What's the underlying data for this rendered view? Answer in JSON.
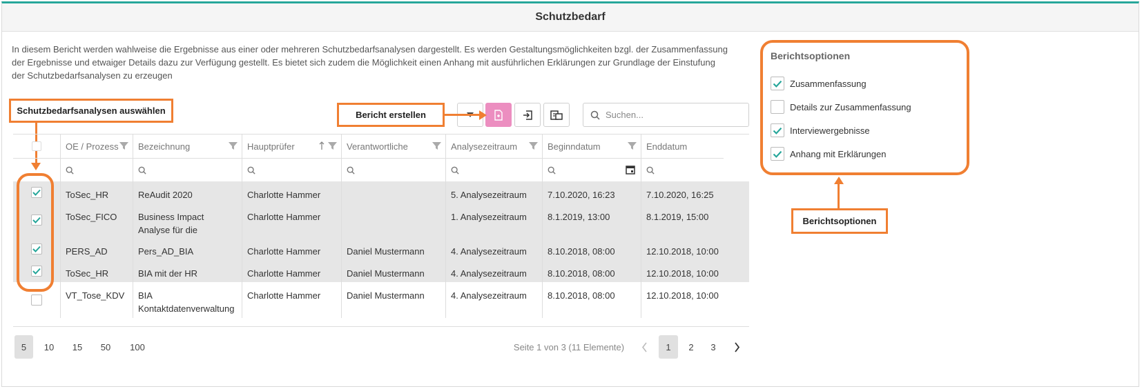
{
  "window": {
    "title": "Schutzbedarf"
  },
  "description": "In diesem Bericht werden wahlweise die Ergebnisse aus einer oder mehreren Schutzbedarfsanalysen dargestellt. Es werden Gestaltungsmöglichkeiten bzgl. der Zusammenfassung der Ergebnisse und etwaiger Details dazu zur Verfügung gestellt. Es bietet sich zudem die Möglichkeit einen Anhang mit ausführlichen Erklärungen zur Grundlage der Einstufung der Schutzbedarfsanalysen zu erzeugen",
  "annotations": {
    "select_analyses": "Schutzbedarfsanalysen auswählen",
    "create_report": "Bericht erstellen",
    "report_options": "Berichtsoptionen"
  },
  "toolbar": {
    "search_placeholder": "Suchen..."
  },
  "table": {
    "columns": [
      "OE / Prozess",
      "Bezeichnung",
      "Hauptprüfer",
      "Verantwortliche",
      "Analysezeitraum",
      "Beginndatum",
      "Enddatum"
    ],
    "rows": [
      {
        "selected": true,
        "oe": "ToSec_HR",
        "bezeichnung": "ReAudit 2020",
        "pruefer": "Charlotte Hammer",
        "verantwortliche": "",
        "zeitraum": "5. Analysezeitraum",
        "beginn": "7.10.2020, 16:23",
        "ende": "7.10.2020, 16:25"
      },
      {
        "selected": true,
        "oe": "ToSec_FICO",
        "bezeichnung": "Business Impact Analyse für die Finanzabteilung",
        "pruefer": "Charlotte Hammer",
        "verantwortliche": "",
        "zeitraum": "1. Analysezeitraum",
        "beginn": "8.1.2019, 13:00",
        "ende": "8.1.2019, 15:00"
      },
      {
        "selected": true,
        "oe": "PERS_AD",
        "bezeichnung": "Pers_AD_BIA",
        "pruefer": "Charlotte Hammer",
        "verantwortliche": "Daniel Mustermann",
        "zeitraum": "4. Analysezeitraum",
        "beginn": "8.10.2018, 08:00",
        "ende": "12.10.2018, 10:00"
      },
      {
        "selected": true,
        "oe": "ToSec_HR",
        "bezeichnung": "BIA mit der HR",
        "pruefer": "Charlotte Hammer",
        "verantwortliche": "Daniel Mustermann",
        "zeitraum": "4. Analysezeitraum",
        "beginn": "8.10.2018, 08:00",
        "ende": "12.10.2018, 10:00"
      },
      {
        "selected": false,
        "oe": "VT_Tose_KDV",
        "bezeichnung": "BIA Kontaktdatenverwaltung",
        "pruefer": "Charlotte Hammer",
        "verantwortliche": "Daniel Mustermann",
        "zeitraum": "4. Analysezeitraum",
        "beginn": "8.10.2018, 08:00",
        "ende": "12.10.2018, 10:00"
      }
    ]
  },
  "pager": {
    "sizes": [
      "5",
      "10",
      "15",
      "50",
      "100"
    ],
    "info": "Seite 1 von 3 (11 Elemente)",
    "pages": [
      "1",
      "2",
      "3"
    ]
  },
  "options": {
    "title": "Berichtsoptionen",
    "items": [
      {
        "label": "Zusammenfassung",
        "checked": true
      },
      {
        "label": "Details zur Zusammenfassung",
        "checked": false
      },
      {
        "label": "Interviewergebnisse",
        "checked": true
      },
      {
        "label": "Anhang mit Erklärungen",
        "checked": true
      }
    ]
  },
  "colors": {
    "accent": "#26a69a",
    "annotation": "#f07f32",
    "primary_button": "#ec8ec0",
    "selected_row": "#e6e6e6"
  }
}
